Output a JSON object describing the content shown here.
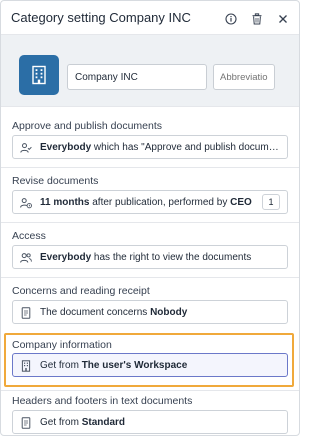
{
  "header": {
    "title": "Category setting Company INC",
    "icons": [
      "info-icon",
      "trash-icon",
      "close-icon"
    ]
  },
  "identity": {
    "icon": "building-icon",
    "accent_color": "#2b6ea6",
    "name_value": "Company INC",
    "abbreviation_placeholder": "Abbreviation"
  },
  "sections": {
    "approve": {
      "label": "Approve and publish documents",
      "icon": "users-check-icon",
      "bold": "Everybody",
      "text": " which has \"Approve and publish documents\" enabl..."
    },
    "revise": {
      "label": "Revise documents",
      "icon": "users-clock-icon",
      "bold1": "11 months",
      "text": " after publication, performed by ",
      "bold2": "CEO",
      "count": "1"
    },
    "access": {
      "label": "Access",
      "icon": "users-icon",
      "bold": "Everybody",
      "text": " has the right to view the documents"
    },
    "concerns": {
      "label": "Concerns and reading receipt",
      "icon": "document-icon",
      "text": "The document concerns ",
      "bold": "Nobody"
    },
    "company": {
      "label": "Company information",
      "icon": "building-icon",
      "text": "Get from ",
      "bold": "The user's Workspace",
      "highlight_color": "#f0a93b"
    },
    "headers": {
      "label": "Headers and footers in text documents",
      "icon": "document-icon",
      "text": "Get from ",
      "bold": "Standard"
    }
  }
}
